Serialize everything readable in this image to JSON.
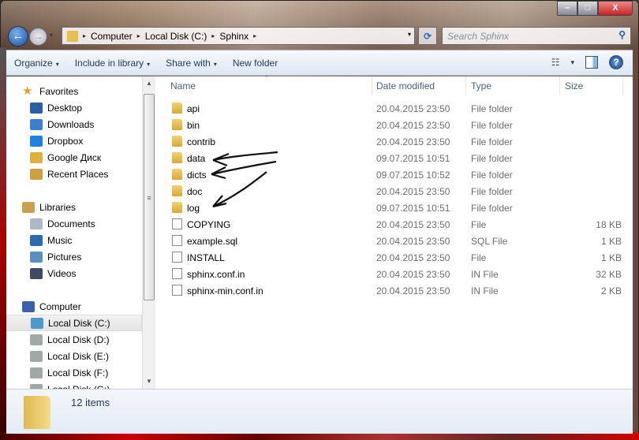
{
  "window": {
    "minimize": "–",
    "maximize": "□",
    "close": "X"
  },
  "nav": {
    "back": "←",
    "forward": "→",
    "dropdown": "▾"
  },
  "address": {
    "crumbs": [
      "Computer",
      "Local Disk (C:)",
      "Sphinx"
    ],
    "separator": "▸",
    "refresh": "⟳"
  },
  "search": {
    "placeholder": "Search Sphinx",
    "icon": "⚲"
  },
  "toolbar": {
    "organize": "Organize",
    "include": "Include in library",
    "share": "Share with",
    "new_folder": "New folder",
    "dd": "▾",
    "help": "?",
    "views": "☷"
  },
  "sidebar": {
    "items": [
      {
        "label": "Favorites",
        "icon": "star-icon",
        "color": "#f0a020"
      },
      {
        "label": "Desktop",
        "icon": "desktop-icon",
        "color": "#2a5fa8"
      },
      {
        "label": "Downloads",
        "icon": "downloads-icon",
        "color": "#3a7fd0"
      },
      {
        "label": "Dropbox",
        "icon": "dropbox-icon",
        "color": "#2080e0"
      },
      {
        "label": "Google Диск",
        "icon": "google-drive-icon",
        "color": "#e0b040"
      },
      {
        "label": "Recent Places",
        "icon": "recent-places-icon",
        "color": "#d0a040"
      },
      {
        "label": "Libraries",
        "icon": "libraries-icon",
        "color": "#c8a050"
      },
      {
        "label": "Documents",
        "icon": "documents-icon",
        "color": "#b0b8c8"
      },
      {
        "label": "Music",
        "icon": "music-icon",
        "color": "#2a6ab0"
      },
      {
        "label": "Pictures",
        "icon": "pictures-icon",
        "color": "#5a90c0"
      },
      {
        "label": "Videos",
        "icon": "videos-icon",
        "color": "#404a60"
      },
      {
        "label": "Computer",
        "icon": "computer-icon",
        "color": "#3a60b0"
      },
      {
        "label": "Local Disk (C:)",
        "icon": "system-drive-icon",
        "color": "#4a9ad0"
      },
      {
        "label": "Local Disk (D:)",
        "icon": "drive-icon",
        "color": "#a0a8a8"
      },
      {
        "label": "Local Disk (E:)",
        "icon": "drive-icon",
        "color": "#a0a8a8"
      },
      {
        "label": "Local Disk (F:)",
        "icon": "drive-icon",
        "color": "#a0a8a8"
      },
      {
        "label": "Local Disk (G:)",
        "icon": "drive-icon",
        "color": "#a0a8a8"
      }
    ]
  },
  "columns": {
    "name": "Name",
    "date": "Date modified",
    "type": "Type",
    "size": "Size"
  },
  "files": [
    {
      "name": "api",
      "date": "20.04.2015 23:50",
      "type": "File folder",
      "size": "",
      "kind": "folder"
    },
    {
      "name": "bin",
      "date": "20.04.2015 23:50",
      "type": "File folder",
      "size": "",
      "kind": "folder"
    },
    {
      "name": "contrib",
      "date": "20.04.2015 23:50",
      "type": "File folder",
      "size": "",
      "kind": "folder"
    },
    {
      "name": "data",
      "date": "09.07.2015 10:51",
      "type": "File folder",
      "size": "",
      "kind": "folder"
    },
    {
      "name": "dicts",
      "date": "09.07.2015 10:52",
      "type": "File folder",
      "size": "",
      "kind": "folder"
    },
    {
      "name": "doc",
      "date": "20.04.2015 23:50",
      "type": "File folder",
      "size": "",
      "kind": "folder"
    },
    {
      "name": "log",
      "date": "09.07.2015 10:51",
      "type": "File folder",
      "size": "",
      "kind": "folder"
    },
    {
      "name": "COPYING",
      "date": "20.04.2015 23:50",
      "type": "File",
      "size": "18 KB",
      "kind": "file"
    },
    {
      "name": "example.sql",
      "date": "20.04.2015 23:50",
      "type": "SQL File",
      "size": "1 KB",
      "kind": "file"
    },
    {
      "name": "INSTALL",
      "date": "20.04.2015 23:50",
      "type": "File",
      "size": "1 KB",
      "kind": "file"
    },
    {
      "name": "sphinx.conf.in",
      "date": "20.04.2015 23:50",
      "type": "IN File",
      "size": "32 KB",
      "kind": "file"
    },
    {
      "name": "sphinx-min.conf.in",
      "date": "20.04.2015 23:50",
      "type": "IN File",
      "size": "2 KB",
      "kind": "file"
    }
  ],
  "status": {
    "count": "12 items"
  }
}
